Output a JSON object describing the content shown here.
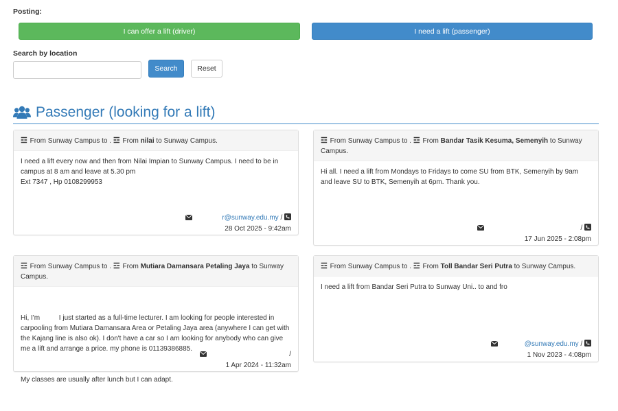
{
  "posting": {
    "label": "Posting:",
    "driver_button": "I can offer a lift (driver)",
    "passenger_button": "I need a lift (passenger)",
    "colors": {
      "driver": "#5cb85c",
      "passenger": "#428bca"
    }
  },
  "search": {
    "label": "Search by location",
    "input_value": "",
    "search_button": "Search",
    "reset_button": "Reset"
  },
  "section": {
    "icon": "users-icon",
    "title": "Passenger (looking for a lift)"
  },
  "cards": [
    {
      "route_prefix": "From Sunway Campus to .",
      "from_word": "From",
      "location": "nilai",
      "route_suffix": "to Sunway Campus.",
      "body_lines": [
        "I need a lift every now and then from Nilai Impian to Sunway Campus. I need to be in campus at 8 am and leave at 5.30 pm",
        "Ext 7347 , Hp 0108299953"
      ],
      "email_user": "r",
      "email_domain": "@sunway.edu.my",
      "separator": "/",
      "date": "28 Oct 2025 - 9:42am"
    },
    {
      "route_prefix": "From Sunway Campus to .",
      "from_word": "From",
      "location": "Bandar Tasik Kesuma, Semenyih",
      "route_suffix": "to Sunway Campus.",
      "body_lines": [
        "Hi all. I need a lift from Mondays to Fridays to come SU from BTK, Semenyih by 9am and leave SU to BTK, Semenyih at 6pm. Thank you."
      ],
      "email_user": "",
      "email_domain": "",
      "separator": "/",
      "date": "17 Jun 2025 - 2:08pm"
    },
    {
      "route_prefix": "From Sunway Campus to .",
      "from_word": "From",
      "location": "Mutiara Damansara Petaling Jaya",
      "route_suffix": "to Sunway Campus.",
      "body_lines": [
        "Hi, I'm          I just started as a full-time lecturer. I am looking for people interested in carpooling from Mutiara Damansara Area or Petaling Jaya area (anywhere I can get with the Kajang line is also ok). I don't have a car so I am looking for anybody who can give me a lift and arrange a price. my phone is 01139386885.",
        "My classes are usually after lunch but I can adapt."
      ],
      "email_user": "",
      "email_domain": "",
      "separator": "/",
      "date": "1 Apr 2024 - 11:32am"
    },
    {
      "route_prefix": "From Sunway Campus to .",
      "from_word": "From",
      "location": "Toll Bandar Seri Putra",
      "route_suffix": "to Sunway Campus.",
      "body_lines": [
        "I need a lift from Bandar Seri Putra to Sunway Uni.. to and fro"
      ],
      "email_user": "",
      "email_domain": "@sunway.edu.my",
      "separator": "/",
      "date": "1 Nov 2023 - 4:08pm"
    }
  ]
}
